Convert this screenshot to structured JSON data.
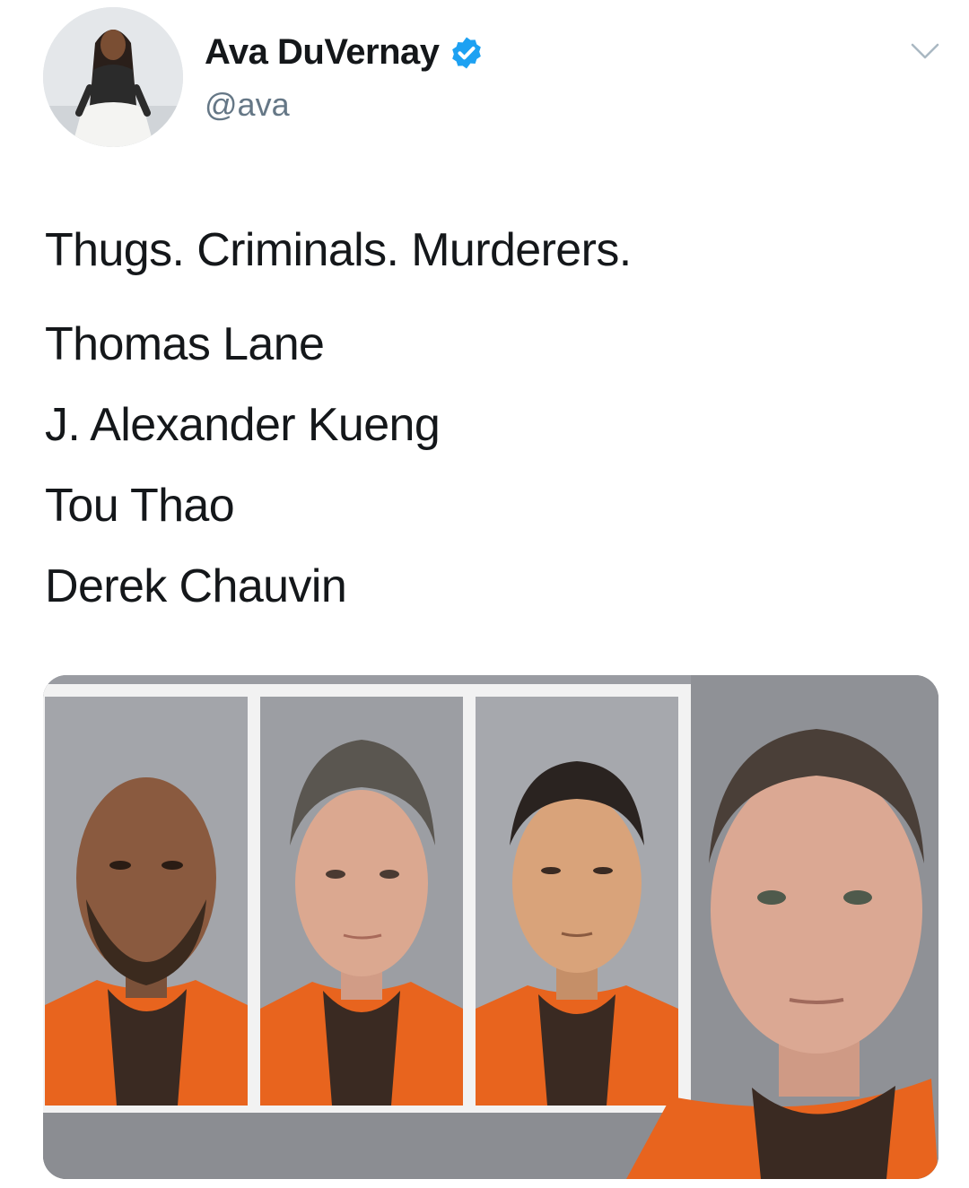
{
  "tweet": {
    "author": {
      "display_name": "Ava DuVernay",
      "handle": "@ava",
      "verified": true,
      "avatar_icon": "profile-photo",
      "verified_icon": "verified-badge-icon"
    },
    "menu_icon": "chevron-down-icon",
    "text_lines": [
      "Thugs. Criminals. Murderers.",
      "Thomas Lane",
      "J. Alexander Kueng",
      "Tou Thao",
      "Derek Chauvin"
    ],
    "media": {
      "description_icon": "mugshot-photos",
      "photo_count": 4
    },
    "colors": {
      "verified_blue": "#1da1f2",
      "handle_gray": "#657786",
      "text": "#14171a",
      "jumpsuit_orange": "#e8641e"
    }
  }
}
